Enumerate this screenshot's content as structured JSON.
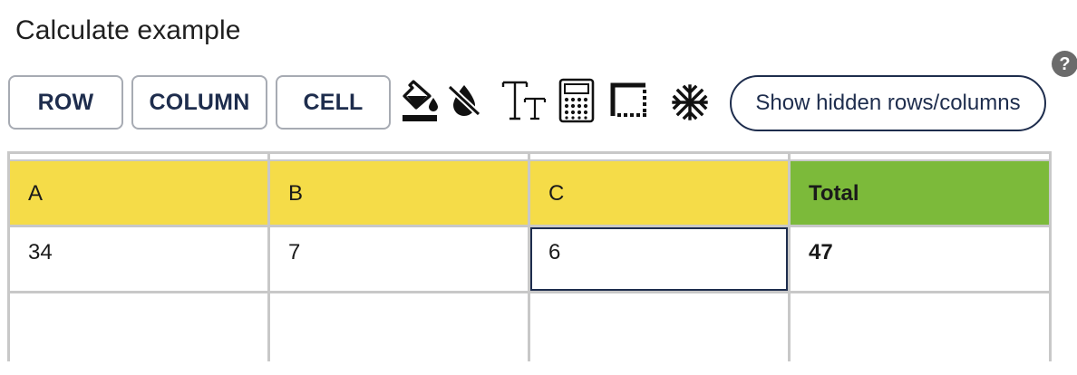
{
  "title": "Calculate example",
  "toolbar": {
    "row_label": "ROW",
    "column_label": "COLUMN",
    "cell_label": "CELL",
    "show_hidden_label": "Show hidden rows/columns",
    "help_glyph": "?",
    "icons": [
      "fill-color-icon",
      "no-fill-icon",
      "text-size-icon",
      "calculator-icon",
      "border-icon",
      "freeze-icon"
    ]
  },
  "table": {
    "headers": [
      "A",
      "B",
      "C",
      "Total"
    ],
    "rows": [
      [
        "34",
        "7",
        "6",
        "47"
      ],
      [
        "",
        "",
        "",
        ""
      ]
    ],
    "selected_cell": "C2"
  },
  "colors": {
    "header_yellow": "#f5dc48",
    "header_green": "#7cba3a",
    "navy": "#1e2d4d",
    "grid": "#c8c8c8"
  }
}
